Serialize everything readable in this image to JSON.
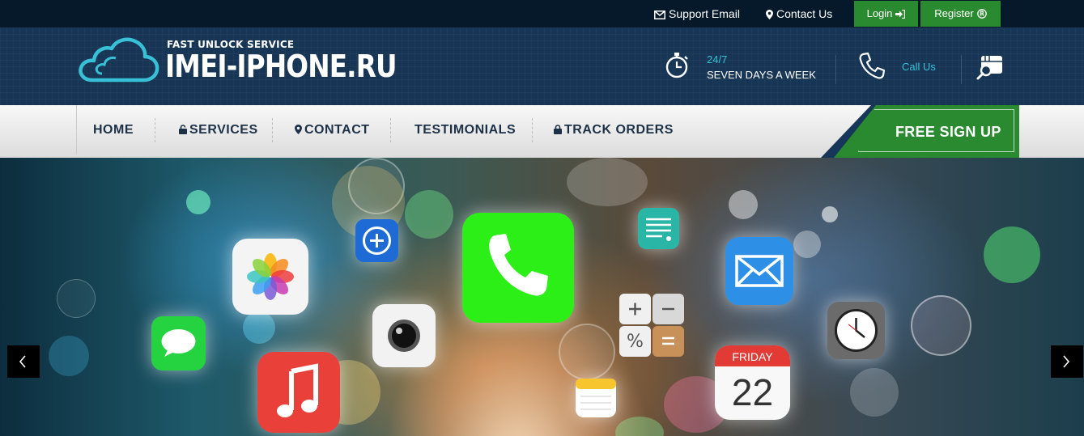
{
  "topbar": {
    "support_email": "Support Email",
    "contact_us": "Contact Us",
    "login": "Login",
    "register": "Register"
  },
  "header": {
    "logo_tagline": "FAST UNLOCK SERVICE",
    "logo_brand": "IMEI-IPHONE.RU",
    "hours_line1": "24/7",
    "hours_line2": "SEVEN DAYS A WEEK",
    "call_label": "Call Us"
  },
  "nav": {
    "items": [
      "HOME",
      "SERVICES",
      "CONTACT",
      "TESTIMONIALS",
      "TRACK ORDERS"
    ],
    "signup": "FREE SIGN UP"
  },
  "hero": {
    "calendar_day": "FRIDAY",
    "calendar_date": "22"
  },
  "colors": {
    "topbar_bg": "#06192b",
    "header_bg": "#173554",
    "accent_green": "#2a8a2f",
    "accent_cyan": "#38c1d6",
    "nav_text": "#1c3147"
  },
  "icons": [
    "envelope-icon",
    "map-marker-icon",
    "sign-in-icon",
    "registered-icon",
    "cloud-logo-icon",
    "stopwatch-icon",
    "phone-icon",
    "search-icon",
    "lock-icon",
    "chevron-left-icon",
    "chevron-right-icon"
  ]
}
